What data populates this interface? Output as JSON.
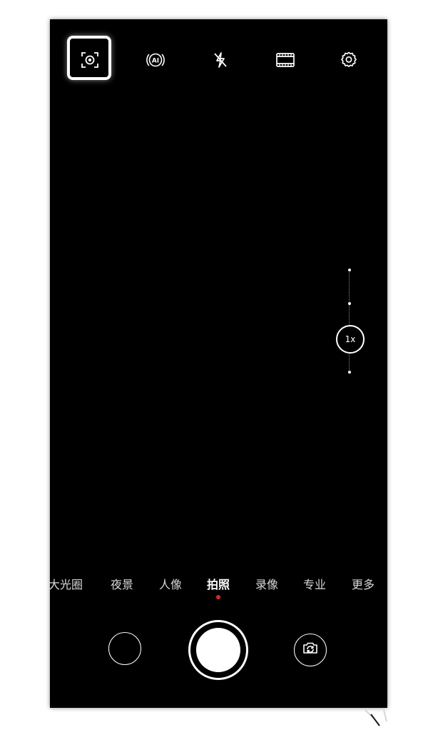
{
  "toolbar": {
    "icons": [
      {
        "name": "smart-scan-icon",
        "highlighted": true
      },
      {
        "name": "ai-icon",
        "label": "AI"
      },
      {
        "name": "flash-off-icon"
      },
      {
        "name": "aspect-ratio-icon"
      },
      {
        "name": "settings-gear-icon"
      }
    ]
  },
  "zoom": {
    "label": "1x"
  },
  "modes": {
    "items": [
      "大光圈",
      "夜景",
      "人像",
      "拍照",
      "录像",
      "专业",
      "更多"
    ],
    "active": "拍照"
  },
  "colors": {
    "background": "#000000",
    "foreground": "#ffffff",
    "active_indicator": "#e0242b"
  }
}
